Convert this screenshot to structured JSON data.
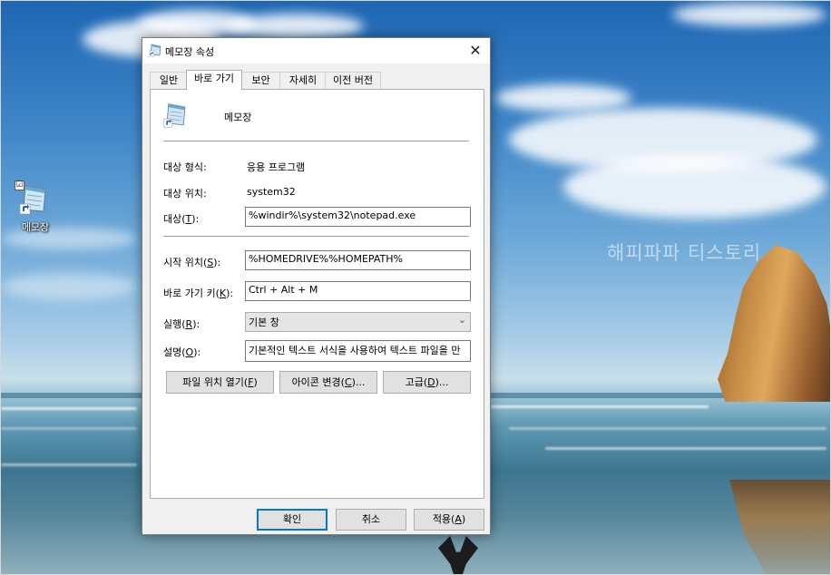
{
  "desktop": {
    "watermark": "해피파파 티스토리",
    "icon_label": "메모장",
    "icon_check": "☑"
  },
  "dialog": {
    "title": "메모장 속성",
    "close_glyph": "✕",
    "tabs": [
      {
        "label": "일반"
      },
      {
        "label": "바로 가기",
        "active": true
      },
      {
        "label": "보안"
      },
      {
        "label": "자세히"
      },
      {
        "label": "이전 버전"
      }
    ],
    "app_name": "메모장",
    "target_type_label": "대상 형식:",
    "target_type_value": "응용 프로그램",
    "target_location_label": "대상 위치:",
    "target_location_value": "system32",
    "target_label": "대상(",
    "target_key": "T",
    "target_label_end": "):",
    "target_value": "%windir%\\system32\\notepad.exe",
    "start_in_label": "시작 위치(",
    "start_in_key": "S",
    "start_in_label_end": "):",
    "start_in_value": "%HOMEDRIVE%%HOMEPATH%",
    "shortcut_key_label": "바로 가기 키(",
    "shortcut_key_key": "K",
    "shortcut_key_label_end": "):",
    "shortcut_key_value": "Ctrl + Alt + M",
    "run_label": "실행(",
    "run_key": "R",
    "run_label_end": "):",
    "run_value": "기본 창",
    "comment_label": "설명(",
    "comment_key": "O",
    "comment_label_end": "):",
    "comment_value": "기본적인 텍스트 서식을 사용하여 텍스트 파일을 만",
    "buttons": {
      "open_location_pre": "파일 위치 열기(",
      "open_location_key": "F",
      "open_location_post": ")",
      "change_icon_pre": "아이콘 변경(",
      "change_icon_key": "C",
      "change_icon_post": ")...",
      "advanced_pre": "고급(",
      "advanced_key": "D",
      "advanced_post": ")..."
    },
    "footer": {
      "ok": "확인",
      "cancel": "취소",
      "apply_pre": "적용(",
      "apply_key": "A",
      "apply_post": ")"
    }
  },
  "icons": [
    "notepad-icon",
    "shortcut-arrow-icon",
    "close-icon",
    "chevron-down-icon",
    "checkbox-icon"
  ],
  "colors": {
    "dialog_bg": "#f0f0f0",
    "panel_bg": "#ffffff",
    "default_button_border": "#0078d7",
    "sky": "#3f86c8",
    "rock": "#c58a45"
  }
}
